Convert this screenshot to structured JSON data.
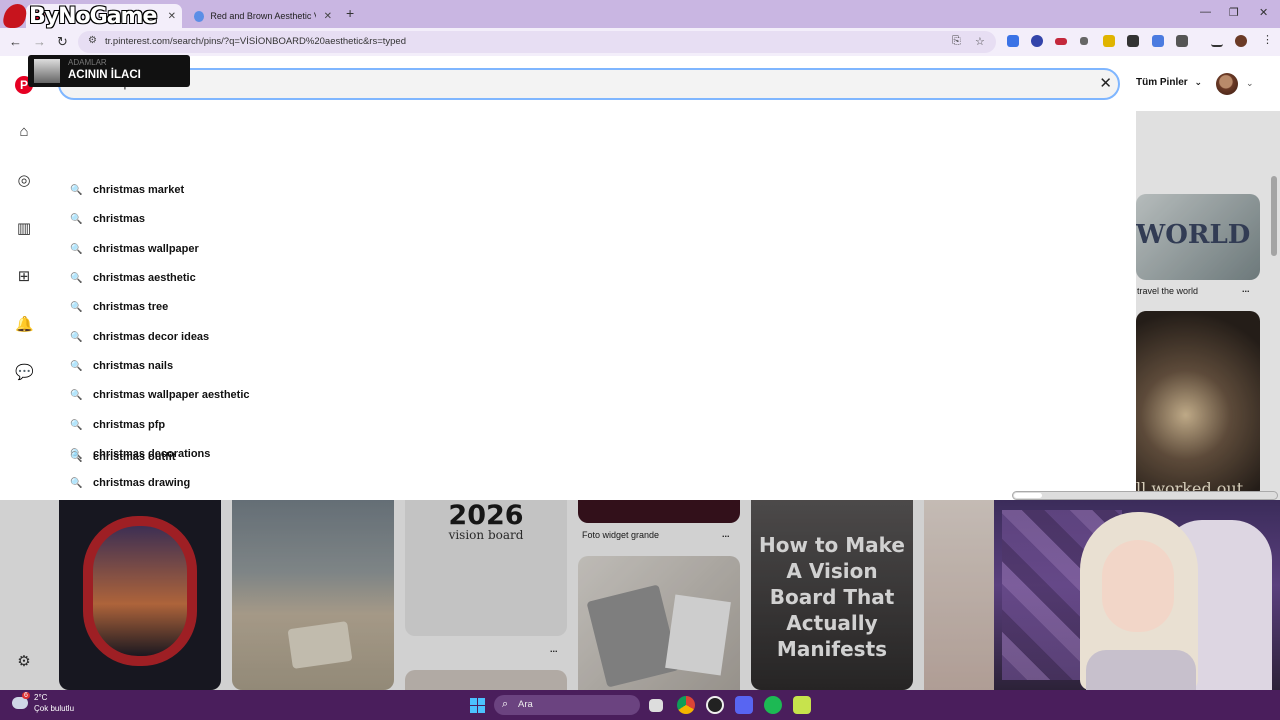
{
  "browser": {
    "tabs": [
      {
        "label": "",
        "active": true
      },
      {
        "label": "Red and Brown Aesthetic Vision",
        "active": false
      }
    ],
    "new_tab": "+",
    "url": "tr.pinterest.com/search/pins/?q=VİSİONBOARD%20aesthetic&rs=typed"
  },
  "watermark": {
    "logo_text": "ByNoGame"
  },
  "stream_badge": {
    "line1": "ADAMLAR",
    "line2": "ACININ İLACI"
  },
  "pinterest": {
    "search_value": "christmas|",
    "filter_label": "Tüm Pinler",
    "suggestions": [
      "christmas market",
      "christmas",
      "christmas wallpaper",
      "christmas aesthetic",
      "christmas tree",
      "christmas decor ideas",
      "christmas nails",
      "christmas wallpaper aesthetic",
      "christmas pfp",
      "christmas decorations",
      "christmas drawing",
      "christmas outfit"
    ],
    "pins": {
      "travel_title": "travel the world",
      "travel_image_text": "WORLD",
      "candle_image_text": "ll worked out",
      "vision_year": "2026",
      "vision_sub": "vision board",
      "foto_title": "Foto widget grande",
      "howto_text": "How to Make A Vision Board That Actually Manifests",
      "more": "..."
    }
  },
  "taskbar": {
    "weather_temp": "2°C",
    "weather_desc": "Çok bulutlu",
    "search_label": "Ara",
    "badge_count": "6"
  }
}
